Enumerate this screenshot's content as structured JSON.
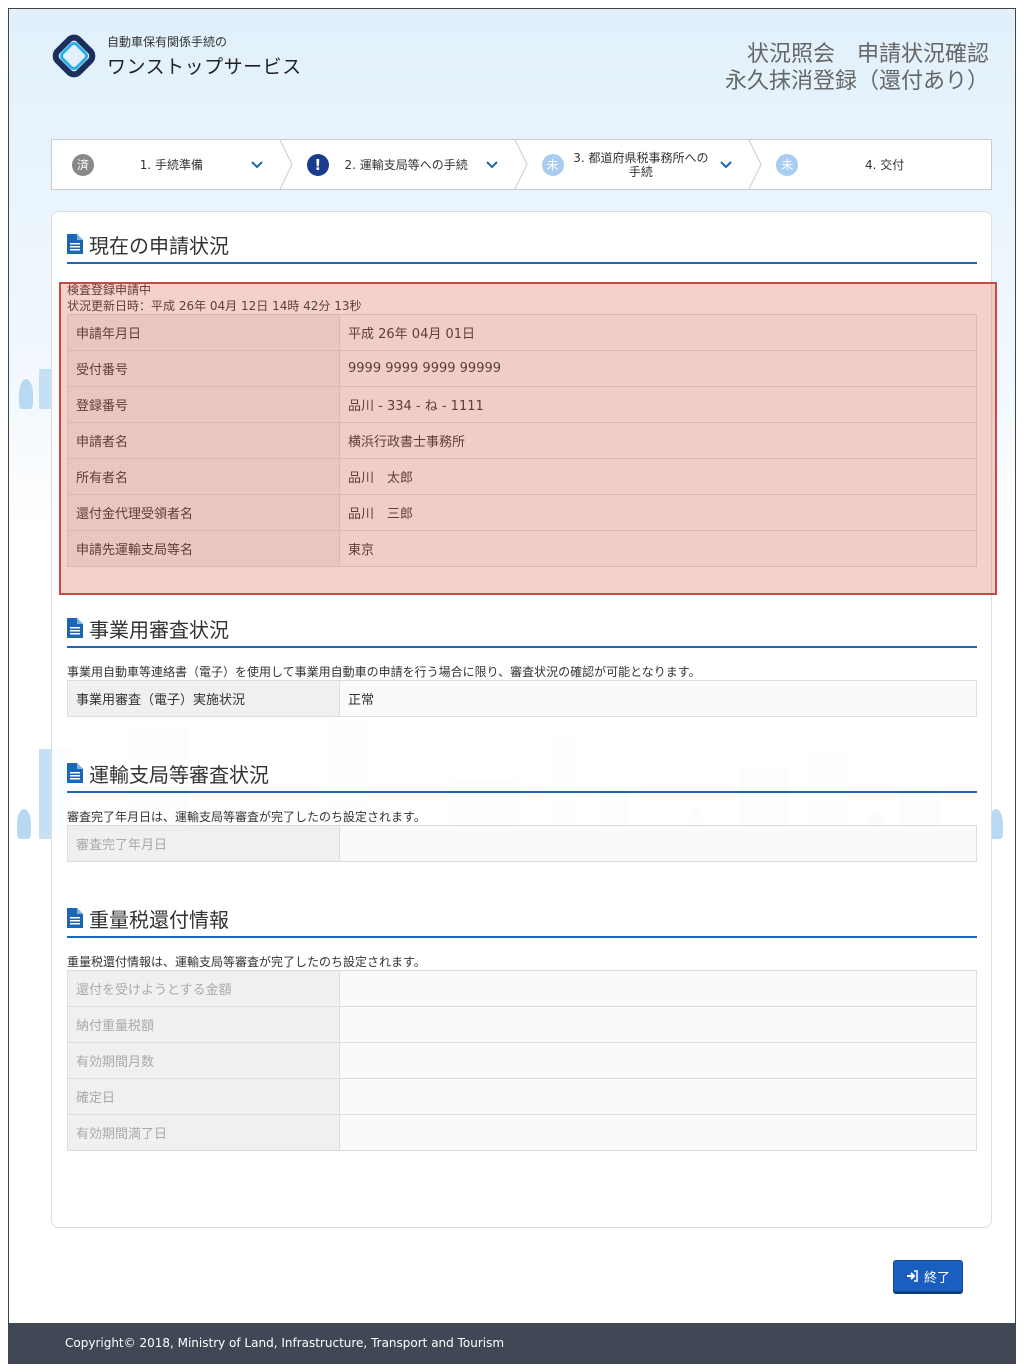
{
  "header": {
    "logo_sub": "自動車保有関係手続の",
    "logo_main": "ワンストップサービス",
    "title_line1": "状況照会　申請状況確認",
    "title_line2": "永久抹消登録（還付あり）"
  },
  "steps": [
    {
      "badge": "済",
      "label": "1. 手続準備"
    },
    {
      "badge": "!",
      "label": "2. 運輸支局等への手続"
    },
    {
      "badge": "未",
      "label": "3. 都道府県税事務所への手続"
    },
    {
      "badge": "未",
      "label": "4. 交付"
    }
  ],
  "current_status": {
    "heading": "現在の申請状況",
    "status": "検査登録申請中",
    "updated": "状況更新日時：平成 26年 04月 12日 14時 42分 13秒",
    "rows": [
      {
        "label": "申請年月日",
        "value": "平成 26年 04月 01日"
      },
      {
        "label": "受付番号",
        "value": "9999 9999 9999 99999"
      },
      {
        "label": "登録番号",
        "value": "品川 - 334 - ね - 1111"
      },
      {
        "label": "申請者名",
        "value": "横浜行政書士事務所"
      },
      {
        "label": "所有者名",
        "value": "品川　太郎"
      },
      {
        "label": "還付金代理受領者名",
        "value": "品川　三郎"
      },
      {
        "label": "申請先運輸支局等名",
        "value": "東京"
      }
    ]
  },
  "business_review": {
    "heading": "事業用審査状況",
    "note": "事業用自動車等連絡書（電子）を使用して事業用自動車の申請を行う場合に限り、審査状況の確認が可能となります。",
    "rows": [
      {
        "label": "事業用審査（電子）実施状況",
        "value": "正常"
      }
    ]
  },
  "bureau_review": {
    "heading": "運輸支局等審査状況",
    "note": "審査完了年月日は、運輸支局等審査が完了したのち設定されます。",
    "rows": [
      {
        "label": "審査完了年月日",
        "value": ""
      }
    ]
  },
  "tax_refund": {
    "heading": "重量税還付情報",
    "note": "重量税還付情報は、運輸支局等審査が完了したのち設定されます。",
    "rows": [
      {
        "label": "還付を受けようとする金額",
        "value": ""
      },
      {
        "label": "納付重量税額",
        "value": ""
      },
      {
        "label": "有効期間月数",
        "value": ""
      },
      {
        "label": "確定日",
        "value": ""
      },
      {
        "label": "有効期間満了日",
        "value": ""
      }
    ]
  },
  "actions": {
    "exit_label": "終了"
  },
  "footer": {
    "copyright": "Copyright© 2018, Ministry of Land, Infrastructure, Transport and Tourism"
  },
  "colors": {
    "accent": "#1d66b3",
    "highlight_border": "#c94a44",
    "footer_bg": "#414855"
  }
}
